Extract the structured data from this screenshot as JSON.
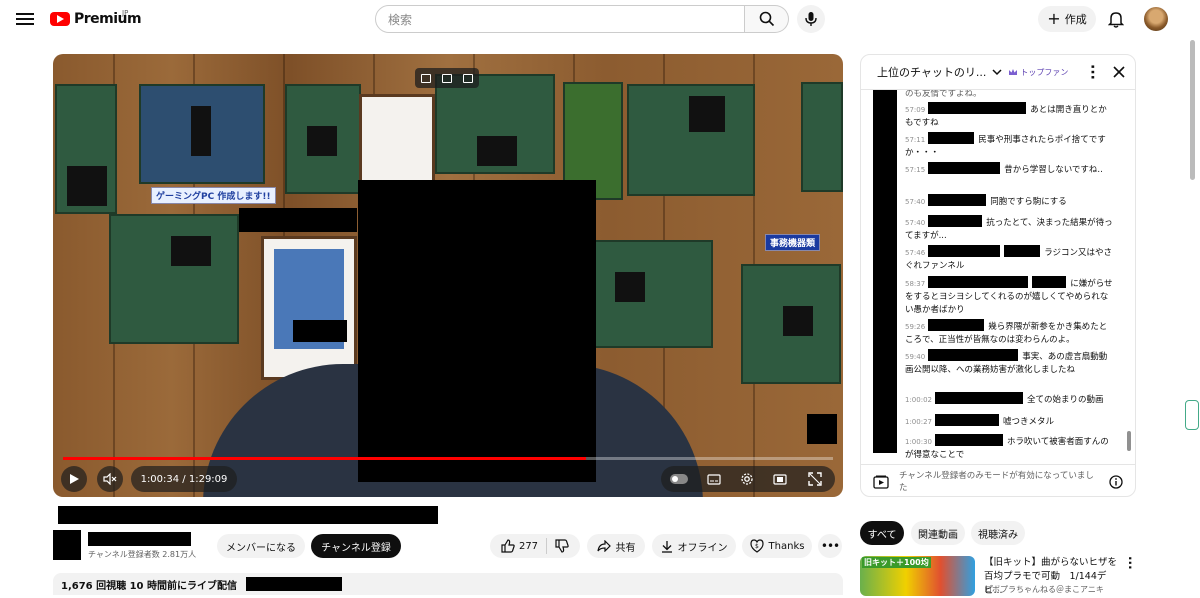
{
  "header": {
    "brand": "Premium",
    "region": "JP",
    "search_placeholder": "検索",
    "create_label": "作成"
  },
  "player": {
    "time": "1:00:34 / 1:29:09",
    "progress": 0.679,
    "wall_sign": "ゲーミングPC 作成します!!",
    "wall_sign_2": "事務機器類"
  },
  "video_info": {
    "subscribers": "チャンネル登録者数 2.81万人",
    "member_label": "メンバーになる",
    "subscribe_label": "チャンネル登録",
    "likes": "277",
    "share_label": "共有",
    "offline_label": "オフライン",
    "thanks_label": "Thanks",
    "views_line": "1,676 回視聴  10 時間前にライブ配信"
  },
  "chat": {
    "title": "上位のチャットのリ...",
    "top_fan": "トップファン",
    "footer_text": "チャンネル登録者のみモードが有効になっていました",
    "partial_top": "のも友情ですよね。",
    "messages": [
      {
        "ts": "57:09",
        "text": "あとは開き直りとかもですね"
      },
      {
        "ts": "57:11",
        "text": "民事や刑事されたらポイ捨てですか・・・"
      },
      {
        "ts": "57:15",
        "text": "昔から学習しないですね.."
      },
      {
        "ts": "57:40",
        "text": "同胞ですら駒にする"
      },
      {
        "ts": "57:40",
        "text": "抗ったとて、決まった結果が待ってますが..."
      },
      {
        "ts": "57:46",
        "text": "ラジコン又はやさぐれファンネル"
      },
      {
        "ts": "58:37",
        "text": "に嫌がらせをするとヨシヨシしてくれるのが嬉しくてやめられない愚か者ばかり"
      },
      {
        "ts": "59:26",
        "text": "幾ら界隈が新参をかき集めたところで、正当性が皆無なのは変わらんのよ。"
      },
      {
        "ts": "59:40",
        "text": "事実、あの虚言扇動動画公開以降、への業務妨害が激化しましたね"
      },
      {
        "ts": "1:00:02",
        "text": "全ての始まりの動画"
      },
      {
        "ts": "1:00:27",
        "text": "嘘つきメタル"
      },
      {
        "ts": "1:00:30",
        "text": "ホラ吹いて被害者面すんのが得意なことで"
      }
    ]
  },
  "related": {
    "tabs": [
      "すべて",
      "関連動画",
      "視聴済み"
    ],
    "item_title": "【旧キット】曲がらないヒザを百均プラモで可動　1/144デビ...",
    "item_channel": "ロボプラちゃんねる＠まこアニキ",
    "thumb_label": "旧キット＋100均"
  },
  "colors": {
    "accent": "#ff0000",
    "dark": "#0f0f0f",
    "muted": "#606060",
    "pill": "#f2f2f2"
  }
}
